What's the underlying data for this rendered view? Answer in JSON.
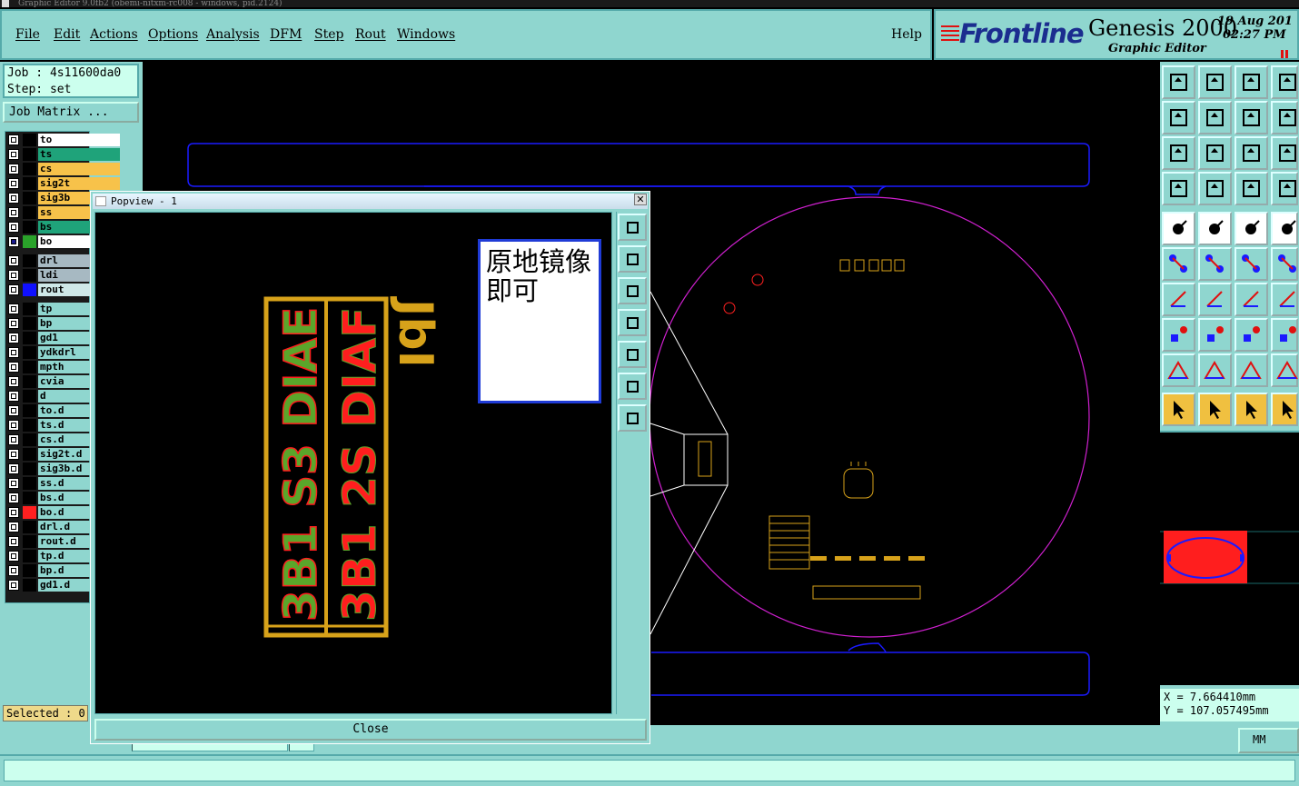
{
  "window": {
    "title": "Graphic Editor 9.0fb2 (obemi-nitxm-rc008 - windows, pid.2124)"
  },
  "menu": [
    "File",
    "Edit",
    "Actions",
    "Options",
    "Analysis",
    "DFM",
    "Step",
    "Rout",
    "Windows"
  ],
  "help": "Help",
  "brand": {
    "logo": "Frontline",
    "product": "Genesis 2000",
    "subtitle": "Graphic Editor",
    "date": "19  Aug  201",
    "time": "02:27  PM"
  },
  "job": {
    "job_line": "Job : 4s11600da0",
    "step_line": "Step: set",
    "matrix_button": "Job Matrix ..."
  },
  "layers": [
    {
      "name": "to",
      "bg": "#ffffff",
      "swatch": "#000000",
      "checked": false
    },
    {
      "name": "ts",
      "bg": "#1fa37a",
      "swatch": "#000000",
      "checked": false
    },
    {
      "name": "cs",
      "bg": "#f7c24a",
      "swatch": "#000000",
      "checked": false
    },
    {
      "name": "sig2t",
      "bg": "#f7c24a",
      "swatch": "#000000",
      "checked": false
    },
    {
      "name": "sig3b",
      "bg": "#f7c24a",
      "swatch": "#000000",
      "checked": false
    },
    {
      "name": "ss",
      "bg": "#f7c24a",
      "swatch": "#000000",
      "checked": false
    },
    {
      "name": "bs",
      "bg": "#1fa37a",
      "swatch": "#000000",
      "checked": false
    },
    {
      "name": "bo",
      "bg": "#ffffff",
      "swatch": "#2aa32a",
      "checked": true
    },
    {
      "name": "drl",
      "bg": "#a7b9c2",
      "swatch": "#000000",
      "checked": false
    },
    {
      "name": "ldi",
      "bg": "#a7b9c2",
      "swatch": "#000000",
      "checked": false
    },
    {
      "name": "rout",
      "bg": "#cfe8e8",
      "swatch": "#1010ff",
      "checked": false
    },
    {
      "name": "tp",
      "bg": "#8fd6cf",
      "swatch": "#000000",
      "checked": false
    },
    {
      "name": "bp",
      "bg": "#8fd6cf",
      "swatch": "#000000",
      "checked": false
    },
    {
      "name": "gd1",
      "bg": "#8fd6cf",
      "swatch": "#000000",
      "checked": false
    },
    {
      "name": "ydkdrl",
      "bg": "#8fd6cf",
      "swatch": "#000000",
      "checked": false
    },
    {
      "name": "mpth",
      "bg": "#8fd6cf",
      "swatch": "#000000",
      "checked": false
    },
    {
      "name": "cvia",
      "bg": "#8fd6cf",
      "swatch": "#000000",
      "checked": false
    },
    {
      "name": "d",
      "bg": "#8fd6cf",
      "swatch": "#000000",
      "checked": false
    },
    {
      "name": "to.d",
      "bg": "#8fd6cf",
      "swatch": "#000000",
      "checked": false
    },
    {
      "name": "ts.d",
      "bg": "#8fd6cf",
      "swatch": "#000000",
      "checked": false
    },
    {
      "name": "cs.d",
      "bg": "#8fd6cf",
      "swatch": "#000000",
      "checked": false
    },
    {
      "name": "sig2t.d",
      "bg": "#8fd6cf",
      "swatch": "#000000",
      "checked": false
    },
    {
      "name": "sig3b.d",
      "bg": "#8fd6cf",
      "swatch": "#000000",
      "checked": false
    },
    {
      "name": "ss.d",
      "bg": "#8fd6cf",
      "swatch": "#000000",
      "checked": false
    },
    {
      "name": "bs.d",
      "bg": "#8fd6cf",
      "swatch": "#000000",
      "checked": false
    },
    {
      "name": "bo.d",
      "bg": "#8fd6cf",
      "swatch": "#ff2020",
      "checked": false
    },
    {
      "name": "drl.d",
      "bg": "#8fd6cf",
      "swatch": "#000000",
      "checked": false
    },
    {
      "name": "rout.d",
      "bg": "#8fd6cf",
      "swatch": "#000000",
      "checked": false
    },
    {
      "name": "tp.d",
      "bg": "#8fd6cf",
      "swatch": "#000000",
      "checked": false
    },
    {
      "name": "bp.d",
      "bg": "#8fd6cf",
      "swatch": "#000000",
      "checked": false
    },
    {
      "name": "gd1.d",
      "bg": "#8fd6cf",
      "swatch": "#000000",
      "checked": false
    }
  ],
  "selected": "Selected : 0",
  "popview": {
    "title": "Popview - 1",
    "close_label": "Close",
    "note": "原地镜像即可",
    "board_text_left": "3B1 S3 DIAE",
    "board_text_right": "3B1 2S DIAF",
    "board_side_text": "JbI"
  },
  "coords": {
    "x": "X = 7.664410mm",
    "y": "Y = 107.057495mm"
  },
  "units": "MM",
  "colors": {
    "panel": "#8fd6cf",
    "outline_blue": "#1a1aff",
    "circle_magenta": "#d020d0",
    "board_yellow": "#d7a21a",
    "text_green": "#5aa62a",
    "text_red": "#ff1e1e"
  },
  "icons": [
    "zoom-home-icon",
    "zoom-in-icon",
    "zoom-out-icon",
    "window-icon",
    "pan-left-icon",
    "pan-right-icon",
    "fit-icon",
    "ratio-icon",
    "help-icon",
    "select-arrow-icon"
  ]
}
